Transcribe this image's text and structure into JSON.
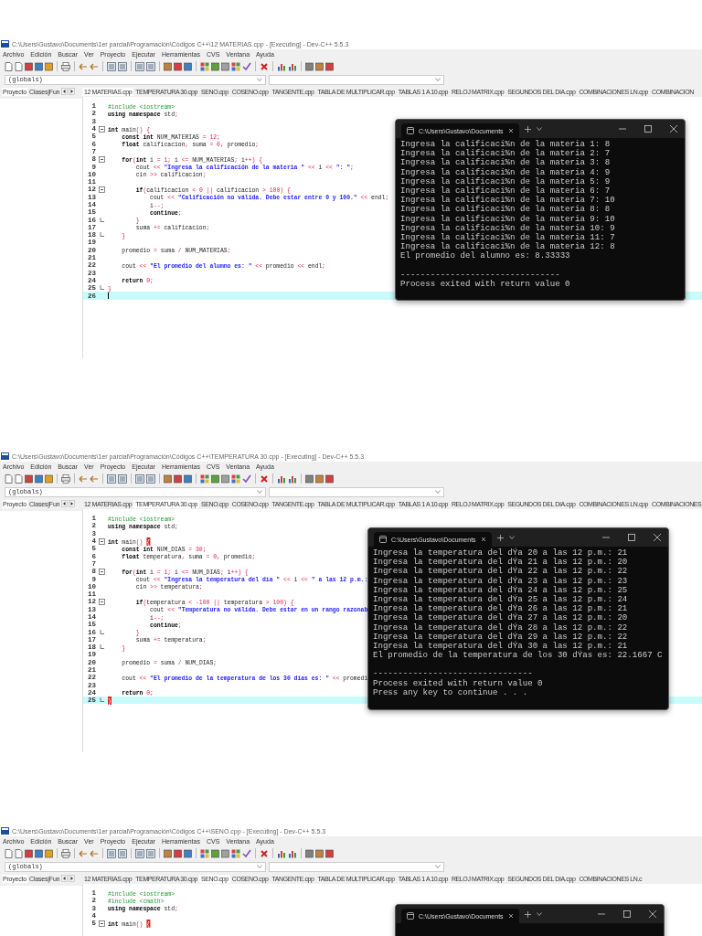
{
  "screenshots": [
    {
      "title": "C:\\Users\\Gustavo\\Documents\\1er parcial\\Programación\\Códigos C++\\12 MATERIAS.cpp - [Executing] - Dev-C++ 5.5.3",
      "menu": [
        "Archivo",
        "Edición",
        "Buscar",
        "Ver",
        "Proyecto",
        "Ejecutar",
        "Herramientas",
        "CVS",
        "Ventana",
        "Ayuda"
      ],
      "scope_field": "(globals)",
      "side_tabs": [
        {
          "label": "Proyecto",
          "selected": true
        },
        {
          "label": "Clases|Fun",
          "selected": false
        }
      ],
      "file_tabs": [
        {
          "label": "12 MATERIAS.cpp",
          "selected": true
        },
        {
          "label": "TEMPERATURA 30.cpp",
          "selected": false
        },
        {
          "label": "SENO.cpp",
          "selected": false
        },
        {
          "label": "COSENO.cpp",
          "selected": false
        },
        {
          "label": "TANGENTE.cpp",
          "selected": false
        },
        {
          "label": "TABLA DE MULTIPLICAR.cpp",
          "selected": false
        },
        {
          "label": "TABLAS 1 A 10.cpp",
          "selected": false
        },
        {
          "label": "RELOJ MATRIX.cpp",
          "selected": false
        },
        {
          "label": "SEGUNDOS DEL DIA.cpp",
          "selected": false
        },
        {
          "label": "COMBINACIONES LN.cpp",
          "selected": false
        },
        {
          "label": "COMBINACION",
          "selected": false
        }
      ],
      "code": [
        {
          "n": "1",
          "segs": [
            {
              "kind": "d",
              "text": "#include <iostream>"
            }
          ]
        },
        {
          "n": "2",
          "segs": [
            {
              "kind": "k",
              "text": "using namespace"
            },
            {
              "kind": "p",
              "text": " std"
            },
            {
              "kind": "r",
              "text": ";"
            }
          ]
        },
        {
          "n": "3"
        },
        {
          "n": "4",
          "fold_start": true,
          "segs": [
            {
              "kind": "k",
              "text": "int"
            },
            {
              "kind": "p",
              "text": " main"
            },
            {
              "kind": "r",
              "text": "() {"
            }
          ]
        },
        {
          "n": "5",
          "segs": [
            {
              "kind": "k",
              "text": "    const int"
            },
            {
              "kind": "p",
              "text": " NUM_MATERIAS "
            },
            {
              "kind": "r",
              "text": "= 12;"
            }
          ]
        },
        {
          "n": "6",
          "segs": [
            {
              "kind": "k",
              "text": "    float"
            },
            {
              "kind": "p",
              "text": " calificacion"
            },
            {
              "kind": "r",
              "text": ", "
            },
            {
              "kind": "p",
              "text": "suma "
            },
            {
              "kind": "r",
              "text": "= 0, "
            },
            {
              "kind": "p",
              "text": "promedio"
            },
            {
              "kind": "r",
              "text": ";"
            }
          ]
        },
        {
          "n": "7"
        },
        {
          "n": "8",
          "fold_start": true,
          "segs": [
            {
              "kind": "k",
              "text": "    for"
            },
            {
              "kind": "r",
              "text": "("
            },
            {
              "kind": "k",
              "text": "int"
            },
            {
              "kind": "p",
              "text": " i "
            },
            {
              "kind": "r",
              "text": "= 1; "
            },
            {
              "kind": "p",
              "text": "i "
            },
            {
              "kind": "r",
              "text": "<= "
            },
            {
              "kind": "p",
              "text": "NUM_MATERIAS"
            },
            {
              "kind": "r",
              "text": "; "
            },
            {
              "kind": "p",
              "text": "i"
            },
            {
              "kind": "r",
              "text": "++) {"
            }
          ]
        },
        {
          "n": "9",
          "segs": [
            {
              "kind": "p",
              "text": "        cout "
            },
            {
              "kind": "r",
              "text": "<< "
            },
            {
              "kind": "s",
              "text": "\"Ingresa la calificación de la materia \""
            },
            {
              "kind": "r",
              "text": " << "
            },
            {
              "kind": "p",
              "text": "i"
            },
            {
              "kind": "r",
              "text": " << "
            },
            {
              "kind": "s",
              "text": "\": \""
            },
            {
              "kind": "r",
              "text": ";"
            }
          ]
        },
        {
          "n": "10",
          "segs": [
            {
              "kind": "p",
              "text": "        cin "
            },
            {
              "kind": "r",
              "text": ">> "
            },
            {
              "kind": "p",
              "text": "calificacion"
            },
            {
              "kind": "r",
              "text": ";"
            }
          ]
        },
        {
          "n": "11"
        },
        {
          "n": "12",
          "fold_start": true,
          "segs": [
            {
              "kind": "k",
              "text": "        if"
            },
            {
              "kind": "r",
              "text": "("
            },
            {
              "kind": "p",
              "text": "calificacion "
            },
            {
              "kind": "r",
              "text": "< 0 || "
            },
            {
              "kind": "p",
              "text": "calificacion "
            },
            {
              "kind": "r",
              "text": "> 100) {"
            }
          ]
        },
        {
          "n": "13",
          "segs": [
            {
              "kind": "p",
              "text": "            cout "
            },
            {
              "kind": "r",
              "text": "<< "
            },
            {
              "kind": "s",
              "text": "\"Calificación no válida. Debe estar entre 0 y 100.\""
            },
            {
              "kind": "r",
              "text": " << "
            },
            {
              "kind": "p",
              "text": "endl"
            },
            {
              "kind": "r",
              "text": ";"
            }
          ]
        },
        {
          "n": "14",
          "segs": [
            {
              "kind": "p",
              "text": "            i"
            },
            {
              "kind": "r",
              "text": "--;"
            }
          ]
        },
        {
          "n": "15",
          "segs": [
            {
              "kind": "k",
              "text": "            continue"
            },
            {
              "kind": "r",
              "text": ";"
            }
          ]
        },
        {
          "n": "16",
          "fold_end": true,
          "segs": [
            {
              "kind": "r",
              "text": "        }"
            }
          ]
        },
        {
          "n": "17",
          "segs": [
            {
              "kind": "p",
              "text": "        suma "
            },
            {
              "kind": "r",
              "text": "+= "
            },
            {
              "kind": "p",
              "text": "calificacion"
            },
            {
              "kind": "r",
              "text": ";"
            }
          ]
        },
        {
          "n": "18",
          "fold_end": true,
          "segs": [
            {
              "kind": "r",
              "text": "    }"
            }
          ]
        },
        {
          "n": "19"
        },
        {
          "n": "20",
          "segs": [
            {
              "kind": "p",
              "text": "    promedio "
            },
            {
              "kind": "r",
              "text": "= "
            },
            {
              "kind": "p",
              "text": "suma "
            },
            {
              "kind": "r",
              "text": "/ "
            },
            {
              "kind": "p",
              "text": "NUM_MATERIAS"
            },
            {
              "kind": "r",
              "text": ";"
            }
          ]
        },
        {
          "n": "21"
        },
        {
          "n": "22",
          "segs": [
            {
              "kind": "p",
              "text": "    cout "
            },
            {
              "kind": "r",
              "text": "<< "
            },
            {
              "kind": "s",
              "text": "\"El promedio del alumno es: \""
            },
            {
              "kind": "r",
              "text": " << "
            },
            {
              "kind": "p",
              "text": "promedio "
            },
            {
              "kind": "r",
              "text": "<< "
            },
            {
              "kind": "p",
              "text": "endl"
            },
            {
              "kind": "r",
              "text": ";"
            }
          ]
        },
        {
          "n": "23"
        },
        {
          "n": "24",
          "segs": [
            {
              "kind": "k",
              "text": "    return"
            },
            {
              "kind": "r",
              "text": " 0;"
            }
          ]
        },
        {
          "n": "25",
          "fold_end": true,
          "segs": [
            {
              "kind": "r",
              "text": "}"
            }
          ]
        },
        {
          "n": "26",
          "current": true
        }
      ],
      "console": {
        "title": "C:\\Users\\Gustavo\\Documents",
        "output": [
          "Ingresa la calificaci%n de la materia 1: 8",
          "Ingresa la calificaci%n de la materia 2: 7",
          "Ingresa la calificaci%n de la materia 3: 8",
          "Ingresa la calificaci%n de la materia 4: 9",
          "Ingresa la calificaci%n de la materia 5: 9",
          "Ingresa la calificaci%n de la materia 6: 7",
          "Ingresa la calificaci%n de la materia 7: 10",
          "Ingresa la calificaci%n de la materia 8: 8",
          "Ingresa la calificaci%n de la materia 9: 10",
          "Ingresa la calificaci%n de la materia 10: 9",
          "Ingresa la calificaci%n de la materia 11: 7",
          "Ingresa la calificaci%n de la materia 12: 8",
          "El promedio del alumno es: 8.33333"
        ],
        "footer": [
          "--------------------------------",
          "Process exited with return value 0"
        ]
      }
    },
    {
      "title": "C:\\Users\\Gustavo\\Documents\\1er parcial\\Programación\\Códigos C++\\TEMPERATURA 30.cpp - [Executing] - Dev-C++ 5.5.3",
      "menu": [
        "Archivo",
        "Edición",
        "Buscar",
        "Ver",
        "Proyecto",
        "Ejecutar",
        "Herramientas",
        "CVS",
        "Ventana",
        "Ayuda"
      ],
      "scope_field": "(globals)",
      "side_tabs": [
        {
          "label": "Proyecto",
          "selected": true
        },
        {
          "label": "Clases|Fun",
          "selected": false
        }
      ],
      "file_tabs": [
        {
          "label": "12 MATERIAS.cpp",
          "selected": false
        },
        {
          "label": "TEMPERATURA 30.cpp",
          "selected": true
        },
        {
          "label": "SENO.cpp",
          "selected": false
        },
        {
          "label": "COSENO.cpp",
          "selected": false
        },
        {
          "label": "TANGENTE.cpp",
          "selected": false
        },
        {
          "label": "TABLA DE MULTIPLICAR.cpp",
          "selected": false
        },
        {
          "label": "TABLAS 1 A 10.cpp",
          "selected": false
        },
        {
          "label": "RELOJ MATRIX.cpp",
          "selected": false
        },
        {
          "label": "SEGUNDOS DEL DIA.cpp",
          "selected": false
        },
        {
          "label": "COMBINACIONES LN.cpp",
          "selected": false
        },
        {
          "label": "COMBINACIONES",
          "selected": false
        }
      ],
      "code": [
        {
          "n": "1",
          "segs": [
            {
              "kind": "d",
              "text": "#include <iostream>"
            }
          ]
        },
        {
          "n": "2",
          "segs": [
            {
              "kind": "k",
              "text": "using namespace"
            },
            {
              "kind": "p",
              "text": " std"
            },
            {
              "kind": "r",
              "text": ";"
            }
          ]
        },
        {
          "n": "3"
        },
        {
          "n": "4",
          "fold_start": true,
          "segs": [
            {
              "kind": "k",
              "text": "int"
            },
            {
              "kind": "p",
              "text": " main"
            },
            {
              "kind": "r",
              "text": "() "
            },
            {
              "kind": "h",
              "text": "{"
            }
          ]
        },
        {
          "n": "5",
          "segs": [
            {
              "kind": "k",
              "text": "    const int"
            },
            {
              "kind": "p",
              "text": " NUM_DIAS "
            },
            {
              "kind": "r",
              "text": "= 30;"
            }
          ]
        },
        {
          "n": "6",
          "segs": [
            {
              "kind": "k",
              "text": "    float"
            },
            {
              "kind": "p",
              "text": " temperatura"
            },
            {
              "kind": "r",
              "text": ", "
            },
            {
              "kind": "p",
              "text": "suma "
            },
            {
              "kind": "r",
              "text": "= 0, "
            },
            {
              "kind": "p",
              "text": "promedio"
            },
            {
              "kind": "r",
              "text": ";"
            }
          ]
        },
        {
          "n": "7"
        },
        {
          "n": "8",
          "fold_start": true,
          "segs": [
            {
              "kind": "k",
              "text": "    for"
            },
            {
              "kind": "r",
              "text": "("
            },
            {
              "kind": "k",
              "text": "int"
            },
            {
              "kind": "p",
              "text": " i "
            },
            {
              "kind": "r",
              "text": "= 1; "
            },
            {
              "kind": "p",
              "text": "i "
            },
            {
              "kind": "r",
              "text": "<= "
            },
            {
              "kind": "p",
              "text": "NUM_DIAS"
            },
            {
              "kind": "r",
              "text": "; "
            },
            {
              "kind": "p",
              "text": "i"
            },
            {
              "kind": "r",
              "text": "++) {"
            }
          ]
        },
        {
          "n": "9",
          "segs": [
            {
              "kind": "p",
              "text": "        cout "
            },
            {
              "kind": "r",
              "text": "<< "
            },
            {
              "kind": "s",
              "text": "\"Ingresa la temperatura del día \""
            },
            {
              "kind": "r",
              "text": " << "
            },
            {
              "kind": "p",
              "text": "i"
            },
            {
              "kind": "r",
              "text": " << "
            },
            {
              "kind": "s",
              "text": "\" a las 12 p.m.:"
            }
          ]
        },
        {
          "n": "10",
          "segs": [
            {
              "kind": "p",
              "text": "        cin "
            },
            {
              "kind": "r",
              "text": ">> "
            },
            {
              "kind": "p",
              "text": "temperatura"
            },
            {
              "kind": "r",
              "text": ";"
            }
          ]
        },
        {
          "n": "11"
        },
        {
          "n": "12",
          "fold_start": true,
          "segs": [
            {
              "kind": "k",
              "text": "        if"
            },
            {
              "kind": "r",
              "text": "("
            },
            {
              "kind": "p",
              "text": "temperatura "
            },
            {
              "kind": "r",
              "text": "< -100 || "
            },
            {
              "kind": "p",
              "text": "temperatura "
            },
            {
              "kind": "r",
              "text": "> 100) {"
            }
          ]
        },
        {
          "n": "13",
          "segs": [
            {
              "kind": "p",
              "text": "            cout "
            },
            {
              "kind": "r",
              "text": "<< "
            },
            {
              "kind": "s",
              "text": "\"Temperatura no válida. Debe estar en un rango razonab"
            }
          ]
        },
        {
          "n": "14",
          "segs": [
            {
              "kind": "p",
              "text": "            i"
            },
            {
              "kind": "r",
              "text": "--;"
            }
          ]
        },
        {
          "n": "15",
          "segs": [
            {
              "kind": "k",
              "text": "            continue"
            },
            {
              "kind": "r",
              "text": ";"
            }
          ]
        },
        {
          "n": "16",
          "fold_end": true,
          "segs": [
            {
              "kind": "r",
              "text": "        }"
            }
          ]
        },
        {
          "n": "17",
          "segs": [
            {
              "kind": "p",
              "text": "        suma "
            },
            {
              "kind": "r",
              "text": "+= "
            },
            {
              "kind": "p",
              "text": "temperatura"
            },
            {
              "kind": "r",
              "text": ";"
            }
          ]
        },
        {
          "n": "18",
          "fold_end": true,
          "segs": [
            {
              "kind": "r",
              "text": "    }"
            }
          ]
        },
        {
          "n": "19"
        },
        {
          "n": "20",
          "segs": [
            {
              "kind": "p",
              "text": "    promedio "
            },
            {
              "kind": "r",
              "text": "= "
            },
            {
              "kind": "p",
              "text": "suma "
            },
            {
              "kind": "r",
              "text": "/ "
            },
            {
              "kind": "p",
              "text": "NUM_DIAS"
            },
            {
              "kind": "r",
              "text": ";"
            }
          ]
        },
        {
          "n": "21"
        },
        {
          "n": "22",
          "segs": [
            {
              "kind": "p",
              "text": "    cout "
            },
            {
              "kind": "r",
              "text": "<< "
            },
            {
              "kind": "s",
              "text": "\"El promedio de la temperatura de los 30 días es: \""
            },
            {
              "kind": "r",
              "text": " << "
            },
            {
              "kind": "p",
              "text": "promedi"
            }
          ]
        },
        {
          "n": "23"
        },
        {
          "n": "24",
          "segs": [
            {
              "kind": "k",
              "text": "    return"
            },
            {
              "kind": "r",
              "text": " 0;"
            }
          ]
        },
        {
          "n": "25",
          "fold_end": true,
          "current": true,
          "segs": [
            {
              "kind": "h",
              "text": "}"
            }
          ]
        }
      ],
      "console": {
        "title": "C:\\Users\\Gustavo\\Documents",
        "output": [
          "Ingresa la temperatura del dÝa 20 a las 12 p.m.: 21",
          "Ingresa la temperatura del dÝa 21 a las 12 p.m.: 20",
          "Ingresa la temperatura del dÝa 22 a las 12 p.m.: 22",
          "Ingresa la temperatura del dÝa 23 a las 12 p.m.: 23",
          "Ingresa la temperatura del dÝa 24 a las 12 p.m.: 25",
          "Ingresa la temperatura del dÝa 25 a las 12 p.m.: 24",
          "Ingresa la temperatura del dÝa 26 a las 12 p.m.: 21",
          "Ingresa la temperatura del dÝa 27 a las 12 p.m.: 20",
          "Ingresa la temperatura del dÝa 28 a las 12 p.m.: 22",
          "Ingresa la temperatura del dÝa 29 a las 12 p.m.: 22",
          "Ingresa la temperatura del dÝa 30 a las 12 p.m.: 21",
          "El promedio de la temperatura de los 30 dÝas es: 22.1667 C"
        ],
        "footer": [
          "--------------------------------",
          "Process exited with return value 0",
          "Press any key to continue . . ."
        ]
      }
    },
    {
      "title": "C:\\Users\\Gustavo\\Documents\\1er parcial\\Programación\\Códigos C++\\SENO.cpp - [Executing] - Dev-C++ 5.5.3",
      "menu": [
        "Archivo",
        "Edición",
        "Buscar",
        "Ver",
        "Proyecto",
        "Ejecutar",
        "Herramientas",
        "CVS",
        "Ventana",
        "Ayuda"
      ],
      "scope_field": "(globals)",
      "side_tabs": [
        {
          "label": "Proyecto",
          "selected": true
        },
        {
          "label": "Clases|Fun",
          "selected": false
        }
      ],
      "file_tabs": [
        {
          "label": "12 MATERIAS.cpp",
          "selected": false
        },
        {
          "label": "TEMPERATURA 30.cpp",
          "selected": false
        },
        {
          "label": "SENO.cpp",
          "selected": true
        },
        {
          "label": "COSENO.cpp",
          "selected": false
        },
        {
          "label": "TANGENTE.cpp",
          "selected": false
        },
        {
          "label": "TABLA DE MULTIPLICAR.cpp",
          "selected": false
        },
        {
          "label": "TABLAS 1 A 10.cpp",
          "selected": false
        },
        {
          "label": "RELOJ MATRIX.cpp",
          "selected": false
        },
        {
          "label": "SEGUNDOS DEL DIA.cpp",
          "selected": false
        },
        {
          "label": "COMBINACIONES LN.c",
          "selected": false
        }
      ],
      "code": [
        {
          "n": "1",
          "segs": [
            {
              "kind": "d",
              "text": "#include <iostream>"
            }
          ]
        },
        {
          "n": "2",
          "segs": [
            {
              "kind": "d",
              "text": "#include <cmath>"
            }
          ]
        },
        {
          "n": "3",
          "segs": [
            {
              "kind": "k",
              "text": "using namespace"
            },
            {
              "kind": "p",
              "text": " std"
            },
            {
              "kind": "r",
              "text": ";"
            }
          ]
        },
        {
          "n": "4"
        },
        {
          "n": "5",
          "fold_start": true,
          "segs": [
            {
              "kind": "k",
              "text": "int"
            },
            {
              "kind": "p",
              "text": " main"
            },
            {
              "kind": "r",
              "text": "() "
            },
            {
              "kind": "h",
              "text": "{"
            }
          ]
        }
      ],
      "console": {
        "title": "C:\\Users\\Gustavo\\Documents"
      }
    }
  ]
}
